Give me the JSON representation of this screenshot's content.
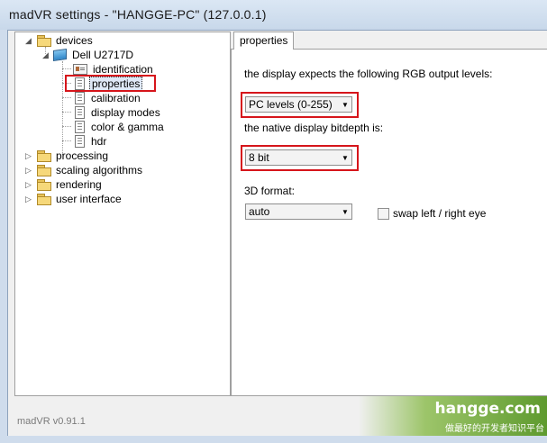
{
  "window": {
    "title": "madVR settings - \"HANGGE-PC\" (127.0.0.1)"
  },
  "tree": {
    "devices": "devices",
    "monitor": "Dell U2717D",
    "children": [
      "identification",
      "properties",
      "calibration",
      "display modes",
      "color & gamma",
      "hdr"
    ],
    "selected": "properties",
    "root_items": [
      "processing",
      "scaling algorithms",
      "rendering",
      "user interface"
    ]
  },
  "panel": {
    "tab": "properties",
    "rgb_label": "the display expects the following RGB output levels:",
    "rgb_value": "PC levels (0-255)",
    "bitdepth_label": "the native display bitdepth is:",
    "bitdepth_value": "8 bit",
    "format_label": "3D format:",
    "format_value": "auto",
    "swap_label": "swap left / right eye",
    "swap_checked": false
  },
  "footer": {
    "version": "madVR v0.91.1"
  },
  "watermark": {
    "main": "hangge.com",
    "sub": "做最好的开发者知识平台"
  },
  "colors": {
    "highlight_box": "#d6151b",
    "titlebar": "#c8d8ea",
    "watermark_green": "#5e9a2e"
  }
}
